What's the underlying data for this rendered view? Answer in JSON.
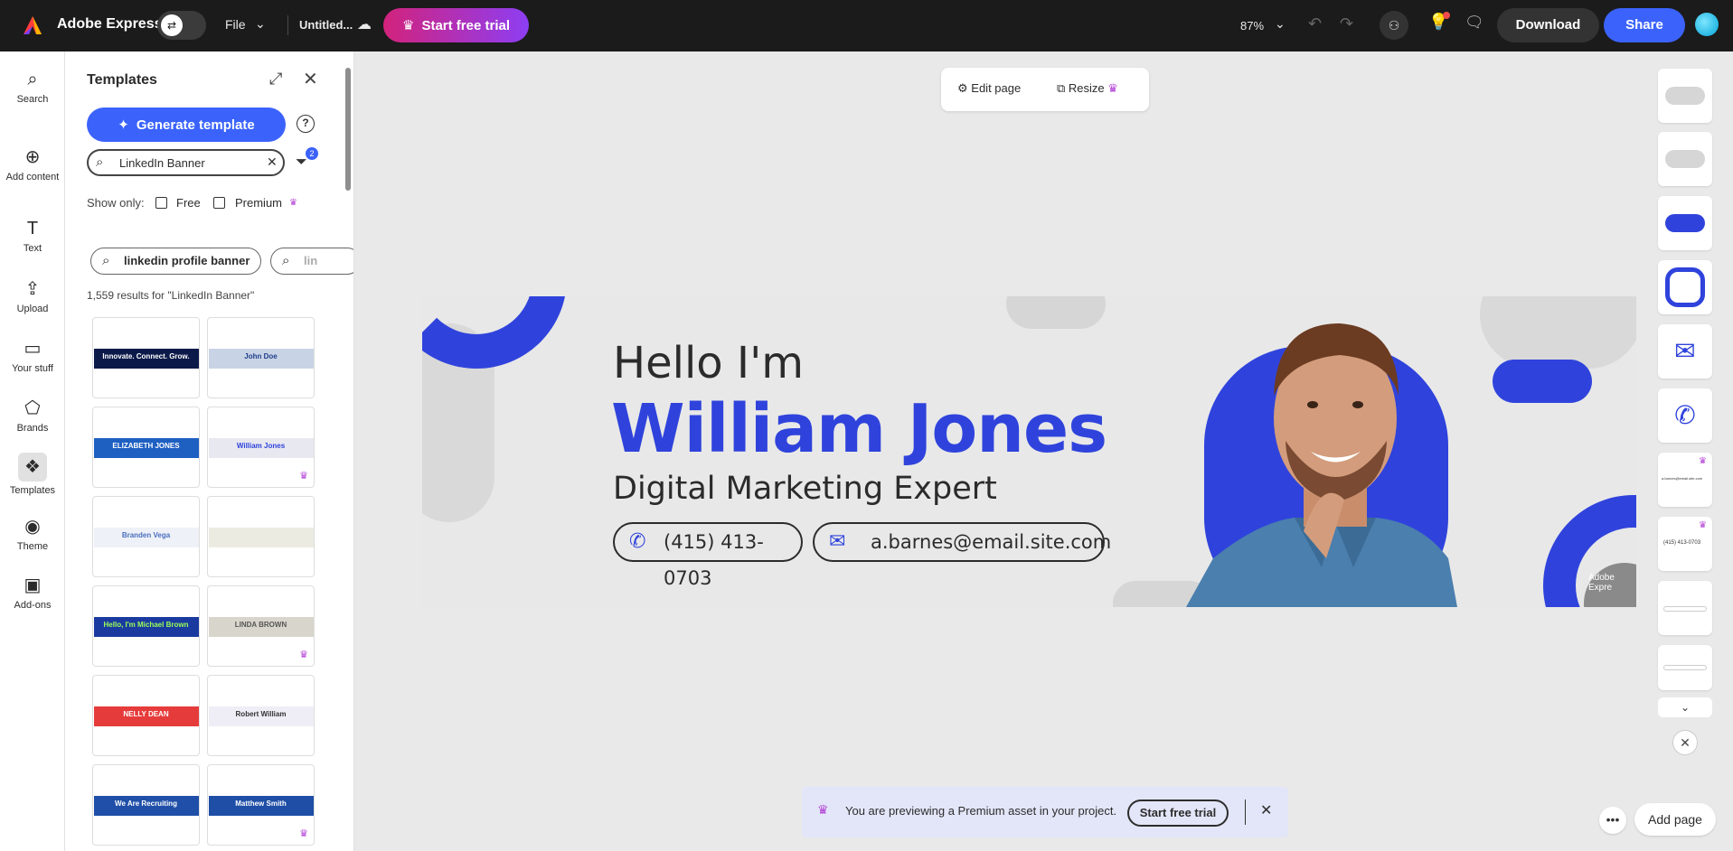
{
  "topbar": {
    "app_name": "Adobe Express",
    "file_menu": "File",
    "doc_title": "Untitled...",
    "trial_button": "Start free trial",
    "zoom": "87%",
    "download": "Download",
    "share": "Share"
  },
  "rail": [
    {
      "label": "Search",
      "icon": "search-icon",
      "glyph": "⌕"
    },
    {
      "label": "Add content",
      "icon": "add-content-icon",
      "glyph": "⊕"
    },
    {
      "label": "Text",
      "icon": "text-icon",
      "glyph": "T"
    },
    {
      "label": "Upload",
      "icon": "upload-icon",
      "glyph": "⇪"
    },
    {
      "label": "Your stuff",
      "icon": "folder-icon",
      "glyph": "▭"
    },
    {
      "label": "Brands",
      "icon": "brands-icon",
      "glyph": "⬠"
    },
    {
      "label": "Templates",
      "icon": "templates-icon",
      "glyph": "❖"
    },
    {
      "label": "Theme",
      "icon": "theme-icon",
      "glyph": "◉"
    },
    {
      "label": "Add-ons",
      "icon": "addons-icon",
      "glyph": "▣"
    }
  ],
  "panel": {
    "title": "Templates",
    "generate_button": "Generate template",
    "search_value": "LinkedIn Banner",
    "filter_count": "2",
    "show_only": "Show only:",
    "free_label": "Free",
    "premium_label": "Premium",
    "chips": [
      "linkedin profile banner",
      "lin"
    ],
    "results": "1,559 results for \"LinkedIn Banner\"",
    "templates": [
      {
        "text": "Innovate. Connect. Grow.",
        "bg": "#0c1a4a",
        "fg": "#ffffff",
        "premium": false
      },
      {
        "text": "John Doe",
        "bg": "#c9d3e6",
        "fg": "#1e3f8a",
        "premium": false
      },
      {
        "text": "ELIZABETH JONES",
        "bg": "#1e5fc2",
        "fg": "#ffffff",
        "premium": false
      },
      {
        "text": "William Jones",
        "bg": "#e8e8f0",
        "fg": "#2f43dc",
        "premium": true
      },
      {
        "text": "Branden Vega",
        "bg": "#eef1f7",
        "fg": "#4a6fbf",
        "premium": false
      },
      {
        "text": "",
        "bg": "#ecebe2",
        "fg": "#555555",
        "premium": false
      },
      {
        "text": "Hello, I'm Michael Brown",
        "bg": "#1a3aa0",
        "fg": "#9cff57",
        "premium": false
      },
      {
        "text": "LINDA BROWN",
        "bg": "#d8d6cc",
        "fg": "#555555",
        "premium": true
      },
      {
        "text": "NELLY DEAN",
        "bg": "#e63b3b",
        "fg": "#ffffff",
        "premium": false
      },
      {
        "text": "Robert William",
        "bg": "#efeef6",
        "fg": "#333333",
        "premium": false
      },
      {
        "text": "We Are Recruiting",
        "bg": "#1f4fa8",
        "fg": "#ffffff",
        "premium": false
      },
      {
        "text": "Matthew Smith",
        "bg": "#1e4ea6",
        "fg": "#ffffff",
        "premium": true
      }
    ]
  },
  "page_toolbar": {
    "edit_page": "Edit page",
    "resize": "Resize"
  },
  "canvas": {
    "greeting": "Hello I'm",
    "name": "William Jones",
    "role": "Digital Marketing Expert",
    "phone": "(415) 413-0703",
    "email": "a.barnes@email.site.com",
    "watermark": "Adobe Expre"
  },
  "right_panel": {
    "thumb_email": "a.barnes@email.site.com",
    "thumb_phone": "(415) 413-0703"
  },
  "notice": {
    "text": "You are previewing a Premium asset in your project.",
    "button": "Start free trial"
  },
  "bottom": {
    "add_page": "Add page"
  },
  "colors": {
    "accent_blue": "#3b63fb",
    "banner_blue": "#2f43dc",
    "premium_purple": "#b23fd6"
  }
}
